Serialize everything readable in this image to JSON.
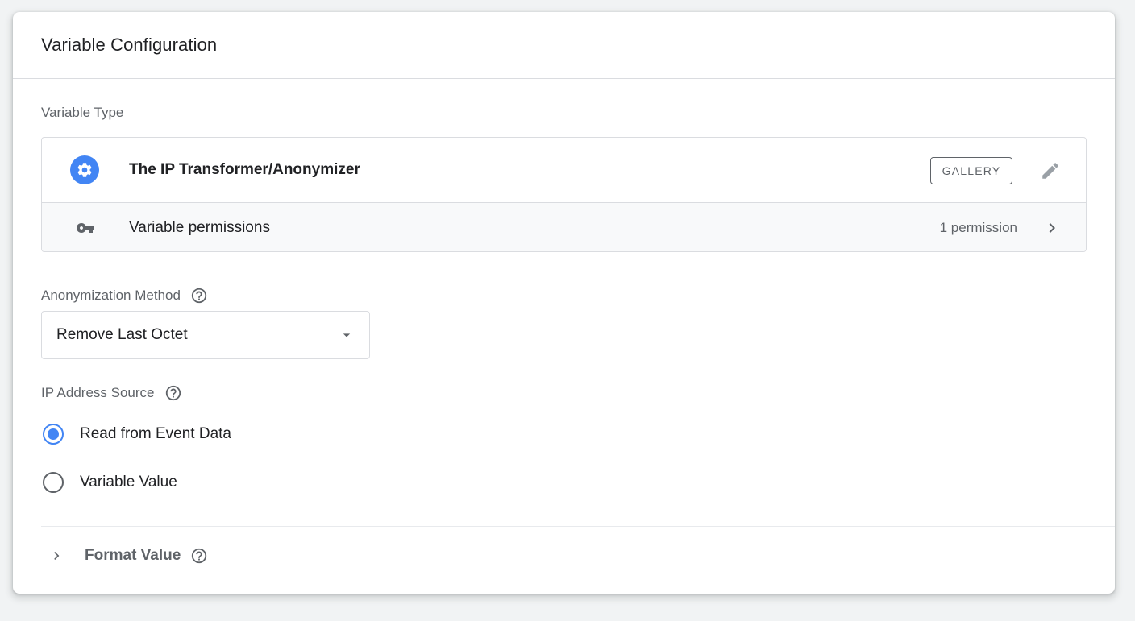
{
  "panel": {
    "title": "Variable Configuration"
  },
  "variable_type": {
    "section_label": "Variable Type",
    "name": "The IP Transformer/Anonymizer",
    "badge": "GALLERY",
    "permissions_label": "Variable permissions",
    "permissions_count": "1 permission"
  },
  "anonymization": {
    "label": "Anonymization Method",
    "selected": "Remove Last Octet"
  },
  "ip_source": {
    "label": "IP Address Source",
    "options": [
      {
        "label": "Read from Event Data",
        "checked": true
      },
      {
        "label": "Variable Value",
        "checked": false
      }
    ]
  },
  "format_value": {
    "label": "Format Value"
  },
  "colors": {
    "accent": "#4285f4",
    "text_primary": "#202124",
    "text_secondary": "#5f6368",
    "border": "#dadce0"
  }
}
